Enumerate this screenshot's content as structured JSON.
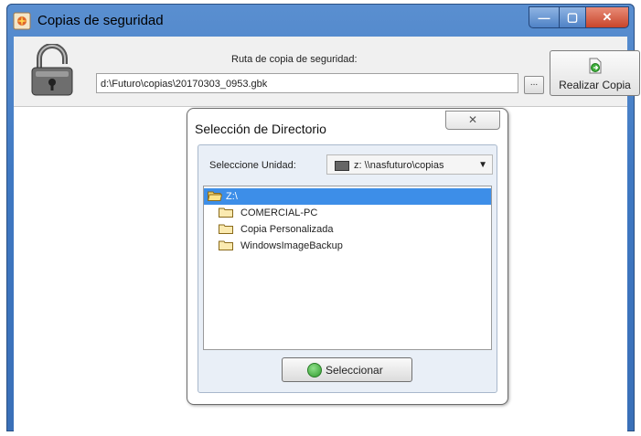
{
  "window": {
    "title": "Copias de seguridad",
    "minimize": "—",
    "maximize": "▢",
    "close": "✕"
  },
  "backup": {
    "route_label": "Ruta de copia de seguridad:",
    "route_value": "d:\\Futuro\\copias\\20170303_0953.gbk",
    "browse_label": "...",
    "backup_button": "Realizar Copia"
  },
  "dialog": {
    "title": "Selección de Directorio",
    "close": "✕",
    "unit_label": "Seleccione Unidad:",
    "unit_value": "z: \\\\nasfuturo\\copias",
    "tree": {
      "root": "Z:\\",
      "children": [
        "COMERCIAL-PC",
        "Copia Personalizada",
        "WindowsImageBackup"
      ]
    },
    "select_button": "Seleccionar"
  },
  "colors": {
    "selection": "#3d8ee8",
    "titlebar": "#4a80c6"
  }
}
